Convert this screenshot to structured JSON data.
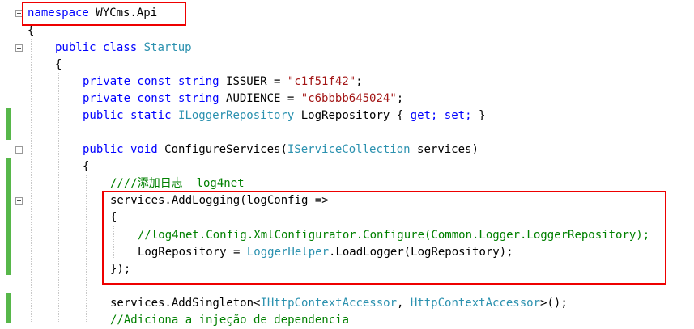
{
  "code": {
    "ns_kw": "namespace",
    "ns_name": "WYCms.Api",
    "open_brace": "{",
    "close_brace": "}",
    "class_public": "public",
    "class_kw": "class",
    "class_name": "Startup",
    "issuer_mods": "private const string",
    "issuer_name": "ISSUER",
    "eq": "=",
    "issuer_value": "\"c1f51f42\"",
    "semi": ";",
    "aud_name": "AUDIENCE",
    "aud_value": "\"c6bbbb645024\"",
    "repo_mods": "public static",
    "repo_type": "ILoggerRepository",
    "repo_name": "LogRepository",
    "brace_open_inline": "{",
    "get_kw": "get;",
    "set_kw": "set;",
    "brace_close_inline": "}",
    "method_mods": "public void",
    "method_name": "ConfigureServices(",
    "param_type": "IServiceCollection",
    "param_name": "services)",
    "comment_log4net": "////添加日志  log4net",
    "add_logging": "services.AddLogging(logConfig =>",
    "comment_configure": "//log4net.Config.XmlConfigurator.Configure(Common.Logger.LoggerRepository);",
    "log_repo_assign": "LogRepository = ",
    "helper_type": "LoggerHelper",
    "load_logger": ".LoadLogger(LogRepository);",
    "close_call": "});",
    "add_singleton": "services.AddSingleton<",
    "http_accessor_iface": "IHttpContextAccessor",
    "comma": ", ",
    "http_accessor_impl": "HttpContextAccessor",
    "singleton_end": ">();",
    "comment_injection": "//Adiciona a injeção de dependencia"
  },
  "colors": {
    "keyword": "#0000ff",
    "type": "#2b91af",
    "string": "#a31515",
    "comment": "#008000",
    "highlight_box": "#e00000",
    "change_bar": "#57b74a"
  }
}
